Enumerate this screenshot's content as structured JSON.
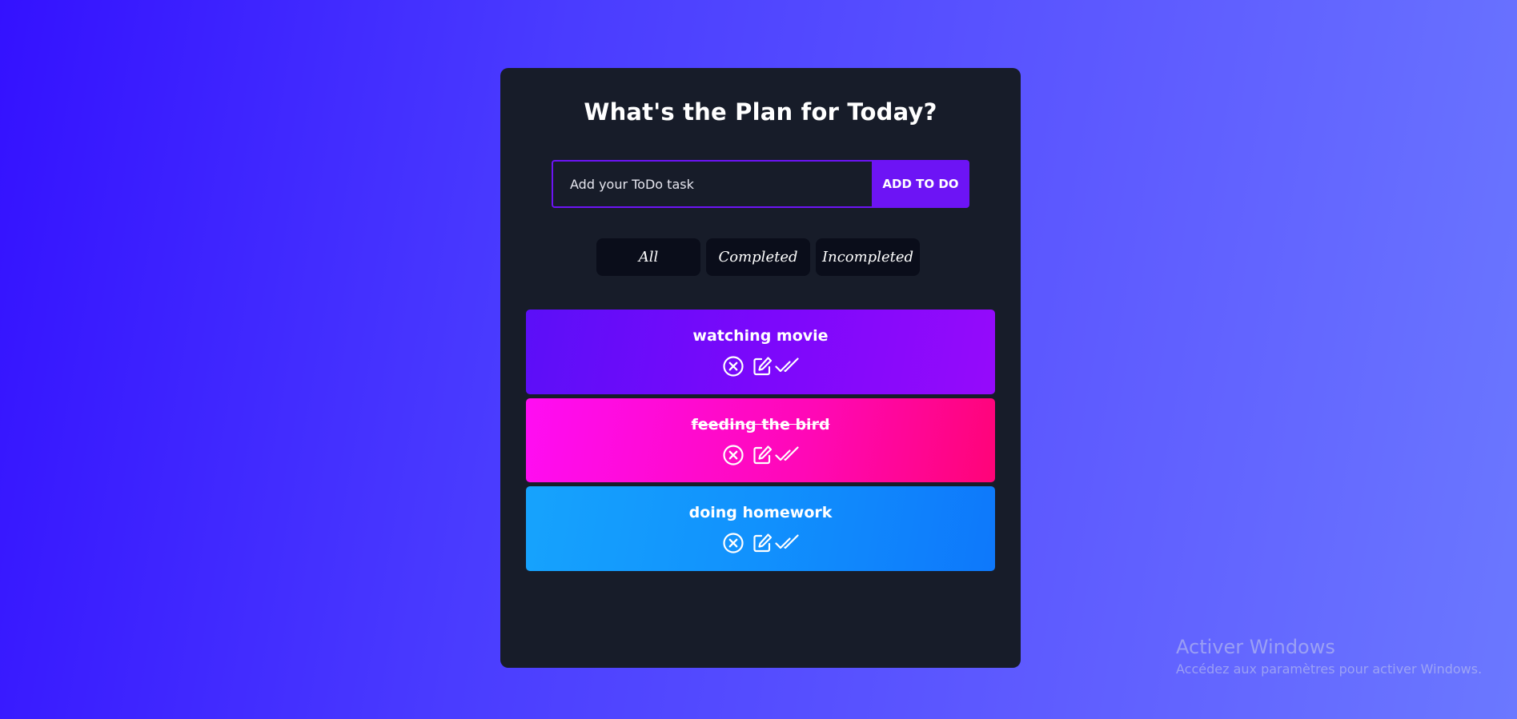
{
  "app": {
    "title": "What's the Plan for Today?",
    "input_placeholder": "Add your ToDo task",
    "input_value": "",
    "add_button_label": "ADD TO DO"
  },
  "filters": [
    {
      "label": "All"
    },
    {
      "label": "Completed"
    },
    {
      "label": "Incompleted"
    }
  ],
  "todos": [
    {
      "text": "watching movie",
      "completed": false,
      "color": "#6e0cfa"
    },
    {
      "text": "feeding the bird",
      "completed": true,
      "color": "#ff08b6"
    },
    {
      "text": "doing homework",
      "completed": false,
      "color": "#128cfd"
    }
  ],
  "item_icons": [
    "close-circle-icon",
    "edit-icon",
    "double-check-icon"
  ],
  "watermark": {
    "title": "Activer Windows",
    "subtitle": "Accédez aux paramètres pour activer Windows."
  },
  "colors": {
    "panel": "#171c29",
    "accent": "#6d14f5",
    "filter_bg": "#0a0d1a"
  }
}
